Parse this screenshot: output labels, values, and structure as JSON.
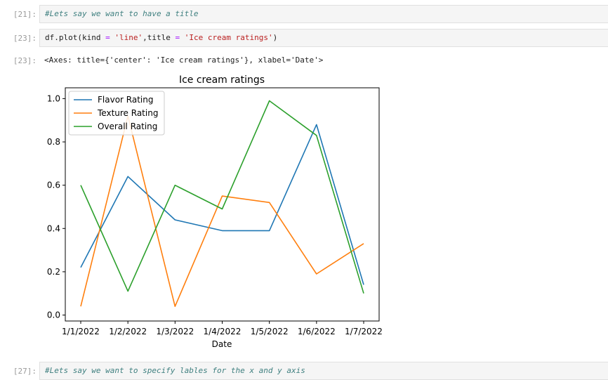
{
  "cells": [
    {
      "prompt": "[21]:",
      "code_comment": "#Lets say we want to have a title"
    },
    {
      "prompt": "[23]:",
      "code_df": "df",
      "code_plot": ".plot(",
      "code_kind": "kind",
      "code_eq1": " = ",
      "code_line": "'line'",
      "code_comma": ",",
      "code_title": "title",
      "code_eq2": " = ",
      "code_titlestr": "'Ice cream ratings'",
      "code_close": ")"
    },
    {
      "prompt": "[23]:",
      "output": "<Axes: title={'center': 'Ice cream ratings'}, xlabel='Date'>"
    },
    {
      "prompt": "[27]:",
      "code_comment": "#Lets say we want to specify lables for the x and y axis"
    }
  ],
  "chart_data": {
    "type": "line",
    "title": "Ice cream ratings",
    "xlabel": "Date",
    "ylabel": "",
    "categories": [
      "1/1/2022",
      "1/2/2022",
      "1/3/2022",
      "1/4/2022",
      "1/5/2022",
      "1/6/2022",
      "1/7/2022"
    ],
    "ylim": [
      0.0,
      1.05
    ],
    "yticks": [
      "0.0",
      "0.2",
      "0.4",
      "0.6",
      "0.8",
      "1.0"
    ],
    "legend_position": "top-left",
    "grid": false,
    "series": [
      {
        "name": "Flavor Rating",
        "color": "#1f77b4",
        "values": [
          0.22,
          0.64,
          0.44,
          0.39,
          0.39,
          0.88,
          0.14
        ]
      },
      {
        "name": "Texture Rating",
        "color": "#ff7f0e",
        "values": [
          0.04,
          0.92,
          0.04,
          0.55,
          0.52,
          0.19,
          0.33
        ]
      },
      {
        "name": "Overall Rating",
        "color": "#2ca02c",
        "values": [
          0.6,
          0.11,
          0.6,
          0.49,
          0.99,
          0.83,
          0.1
        ]
      }
    ]
  }
}
